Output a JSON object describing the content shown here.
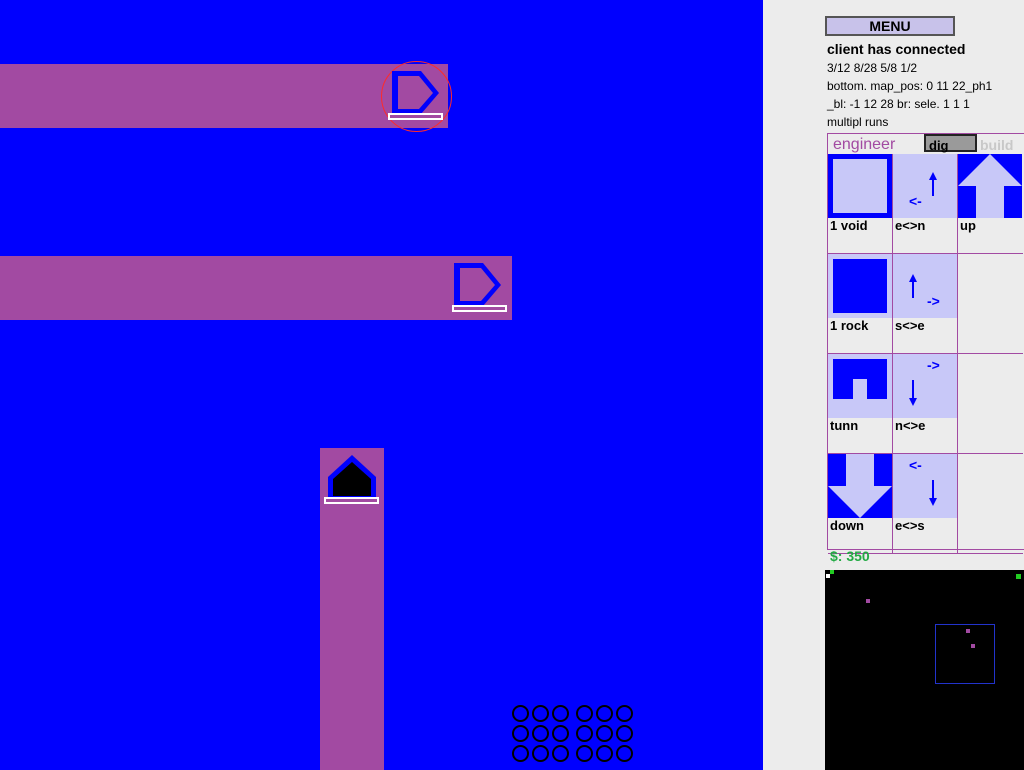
{
  "menu_label": "MENU",
  "status": {
    "connection": "client has connected",
    "line1": "3/12 8/28 5/8 1/2",
    "line2": "bottom.  map_pos: 0 11 22_ph1",
    "line3": "_bl: -1 12 28 br: sele. 1 1 1",
    "line4": "multipl runs"
  },
  "tabs": {
    "engineer": "engineer",
    "dig": "dig",
    "build": "build"
  },
  "tools": [
    {
      "label": "1 void",
      "icon": "void-icon"
    },
    {
      "label": "e<>n",
      "icon": "turn-east-north-icon"
    },
    {
      "label": "up",
      "icon": "up-arrow-icon"
    },
    {
      "label": "1 rock",
      "icon": "rock-icon"
    },
    {
      "label": "s<>e",
      "icon": "turn-south-east-icon"
    },
    {
      "label": "tunn",
      "icon": "tunnel-icon"
    },
    {
      "label": "n<>e",
      "icon": "turn-north-east-icon"
    },
    {
      "label": "down",
      "icon": "down-arrow-icon"
    },
    {
      "label": "e<>s",
      "icon": "turn-east-south-icon"
    }
  ],
  "money": "$: 350",
  "colors": {
    "rock": "#0000fe",
    "tunnel": "#a24aa2",
    "panel_bg": "#ececec",
    "tool_bg": "#c8c8f8",
    "money": "#22aa44",
    "selection": "#ff2a2a"
  }
}
